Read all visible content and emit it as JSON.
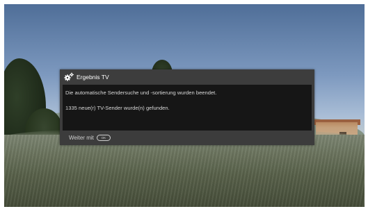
{
  "dialog": {
    "title": "Ergebnis TV",
    "icon": "gears-icon",
    "message_line1": "Die automatische Sendersuche und -sortierung wurden beendet.",
    "message_line2": "1335 neue(r) TV-Sender wurde(n) gefunden.",
    "footer_label": "Weiter mit",
    "ok_button_icon": "ok-remote-button-icon",
    "ok_button_text": "OK"
  }
}
